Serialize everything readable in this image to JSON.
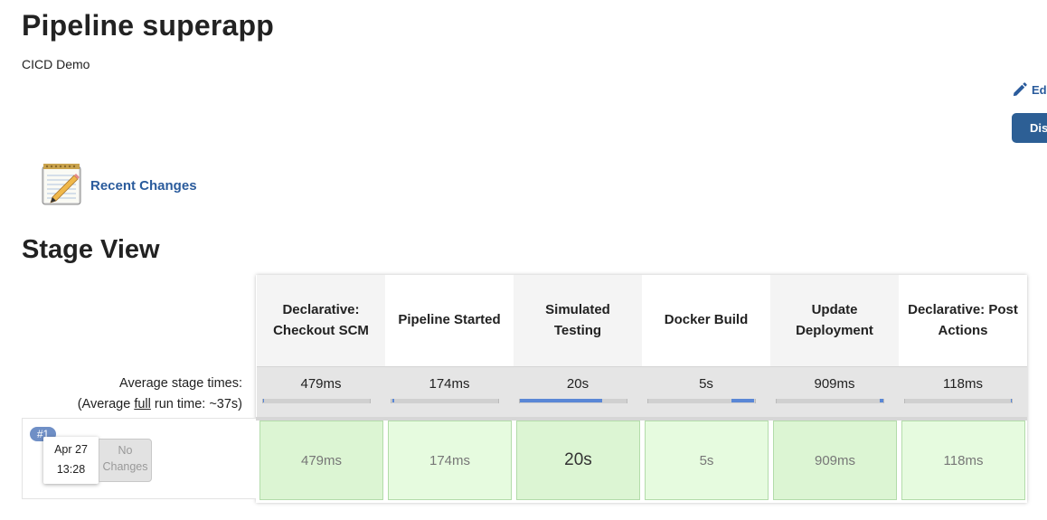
{
  "header": {
    "title": "Pipeline superapp",
    "description": "CICD Demo",
    "edit_label": "Ed",
    "disable_label": "Dis"
  },
  "recent_changes": {
    "label": "Recent Changes",
    "icon": "notepad-pencil-icon"
  },
  "stage_view": {
    "heading": "Stage View",
    "avg_label": "Average stage times:",
    "full_run_prefix": "(Average ",
    "full_run_link": "full",
    "full_run_suffix": " run time: ~37s)",
    "stages": [
      {
        "name": "Declarative: Checkout SCM",
        "avg": "479ms",
        "fill_start": 0.0,
        "fill_end": 0.01
      },
      {
        "name": "Pipeline Started",
        "avg": "174ms",
        "fill_start": 0.01,
        "fill_end": 0.02
      },
      {
        "name": "Simulated Testing",
        "avg": "20s",
        "fill_start": 0.0,
        "fill_end": 0.77
      },
      {
        "name": "Docker Build",
        "avg": "5s",
        "fill_start": 0.78,
        "fill_end": 0.99
      },
      {
        "name": "Update Deployment",
        "avg": "909ms",
        "fill_start": 0.97,
        "fill_end": 1.0
      },
      {
        "name": "Declarative: Post Actions",
        "avg": "118ms",
        "fill_start": 0.99,
        "fill_end": 1.0
      }
    ],
    "runs": [
      {
        "number": "#1",
        "date": "Apr 27",
        "time": "13:28",
        "changes": "No Changes",
        "cells": [
          "479ms",
          "174ms",
          "20s",
          "5s",
          "909ms",
          "118ms"
        ]
      }
    ]
  },
  "colors": {
    "link": "#2a5b9c",
    "button": "#2d5f95",
    "success_cell": "#e6fbdf",
    "bar_fill": "#5a87d6"
  }
}
